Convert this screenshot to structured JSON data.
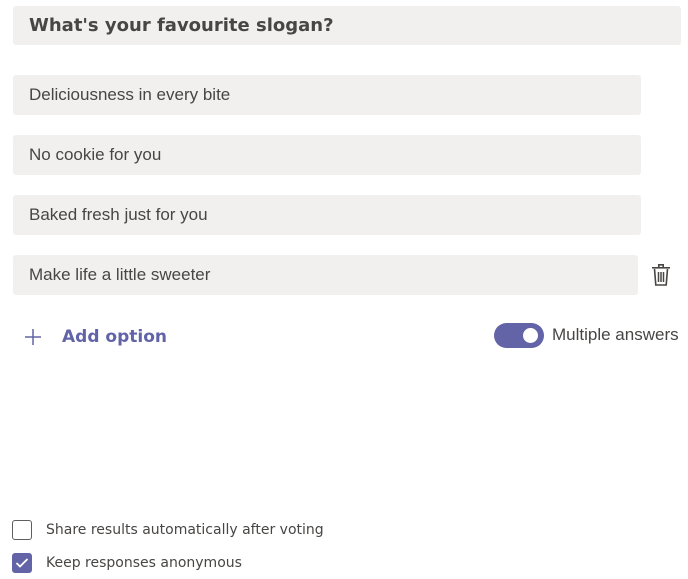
{
  "question": {
    "text": "What's your favourite slogan?"
  },
  "options": [
    {
      "label": "Deliciousness in every bite"
    },
    {
      "label": "No cookie for you"
    },
    {
      "label": "Baked fresh just for you"
    },
    {
      "label": "Make life a little sweeter"
    }
  ],
  "add_option": {
    "label": "Add option",
    "icon": "plus-icon"
  },
  "delete_option": {
    "icon": "trash-icon"
  },
  "multiple_answers": {
    "label": "Multiple answers",
    "enabled": true
  },
  "settings": [
    {
      "label": "Share results automatically after voting",
      "checked": false
    },
    {
      "label": "Keep responses anonymous",
      "checked": true
    }
  ],
  "colors": {
    "accent": "#6264a7",
    "field_bg": "#f1f0ef",
    "text": "#484644"
  }
}
